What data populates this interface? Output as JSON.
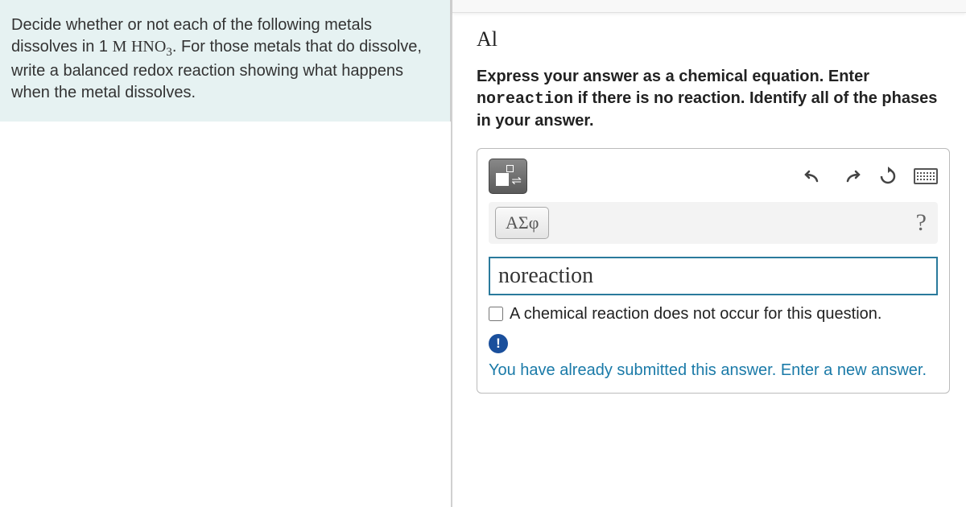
{
  "question": {
    "prefix": "Decide whether or not each of the following metals dissolves in 1 ",
    "formula_m": "M",
    "formula_hno": "HNO",
    "formula_sub": "3",
    "suffix": ". For those metals that do dissolve, write a balanced redox reaction showing what happens when the metal dissolves."
  },
  "part": {
    "label": "Al",
    "instr1": "Express your answer as a chemical equation. Enter ",
    "instr_mono": "noreaction",
    "instr2": " if there is no reaction. Identify all of the phases in your answer."
  },
  "toolbar": {
    "greek_label": "ΑΣφ"
  },
  "answer": {
    "value": "noreaction",
    "checkbox_label": "A chemical reaction does not occur for this question."
  },
  "feedback": {
    "alert": "!",
    "text": "You have already submitted this answer. Enter a new answer."
  }
}
